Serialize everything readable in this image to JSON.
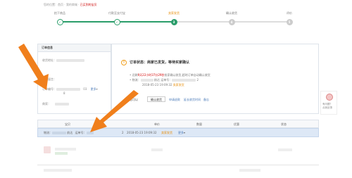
{
  "breadcrumb": {
    "prefix": "您的位置：首页 · 我的商城 · ",
    "current": "已买到的宝贝"
  },
  "steps": [
    {
      "label": "拍下商品",
      "state": "done"
    },
    {
      "label": "付款至支付宝",
      "state": "done"
    },
    {
      "label": "卖家发货",
      "state": "current",
      "num": "3"
    },
    {
      "label": "确认收货",
      "state": "todo",
      "num": "4"
    },
    {
      "label": "评价",
      "state": "todo",
      "num": "5"
    }
  ],
  "order_info": {
    "title": "订单信息",
    "address_label": "收货地址：",
    "message_label": "买家留言：",
    "order_no_label": "订单编号：",
    "order_no_suffix": "03",
    "more": "更多",
    "order_no_tail": "8",
    "seller_label": "商家："
  },
  "status": {
    "title": "订单状态：商家已发货，等待买家确认",
    "line1_prefix": "• 还剩",
    "line1_time": "9天22小时37分29秒",
    "line1_suffix": "卖家确认收货,超时订单自动确认收货",
    "line2_prefix": "• 物流：",
    "line2_mid": "韵达  运单号：",
    "line2_num": "2",
    "line3": "2018-05-23 19:09:32",
    "line3_status": "卖家发货",
    "actions_label": "您可以",
    "confirm_button": "确认收货",
    "apply_return": "申请退款",
    "extend": "延长收货时间",
    "remark": "备忘"
  },
  "table": {
    "headers": [
      "宝贝",
      "单价",
      "数量",
      "优惠",
      "状态"
    ],
    "row_label": "物流：",
    "row_carrier": "韵达",
    "row_waybill_label": "运单号：",
    "row_qty": "2",
    "row_time": "2018-05-23 19:09:32",
    "row_status": "卖家发货",
    "row_more": "更多"
  },
  "sidebar": {
    "feedback": "有问题？",
    "feedback2": "点我反馈"
  },
  "colors": {
    "green": "#2a9d6a",
    "orange": "#e68a00",
    "red": "#d40000",
    "arrow": "#f07f1c"
  }
}
